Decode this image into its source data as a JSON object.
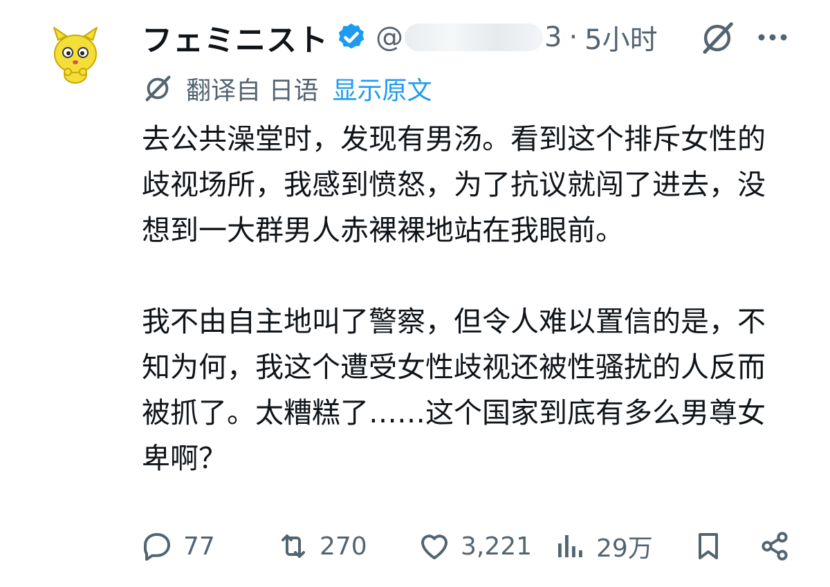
{
  "post": {
    "display_name": "フェミニスト",
    "handle_prefix": "@",
    "handle_suffix": "3",
    "separator": "·",
    "timestamp": "5小时"
  },
  "translation": {
    "label": "翻译自 日语",
    "show_original": "显示原文"
  },
  "main": {
    "paragraphs": [
      "去公共澡堂时，发现有男汤。看到这个排斥女性的歧视场所，我感到愤怒，为了抗议就闯了进去，没想到一大群男人赤裸裸地站在我眼前。",
      "我不由自主地叫了警察，但令人难以置信的是，不知为何，我这个遭受女性歧视还被性骚扰的人反而被抓了。太糟糕了……这个国家到底有多么男尊女卑啊？"
    ]
  },
  "actions": {
    "reply_count": "77",
    "repost_count": "270",
    "like_count": "3,221",
    "view_count": "29万"
  },
  "icons": {
    "avatar": "yellow-cartoon-avatar",
    "verified": "verified-badge-icon",
    "grok": "grok-icon",
    "more": "more-icon",
    "translate": "grok-translate-icon",
    "reply": "reply-icon",
    "repost": "repost-icon",
    "like": "heart-icon",
    "views": "views-chart-icon",
    "bookmark": "bookmark-icon",
    "share": "share-icon"
  },
  "colors": {
    "text": "#0f1419",
    "secondary": "#536471",
    "link": "#1d9bf0",
    "verified": "#1d9bf0",
    "avatar_fill": "#f4de3a"
  }
}
